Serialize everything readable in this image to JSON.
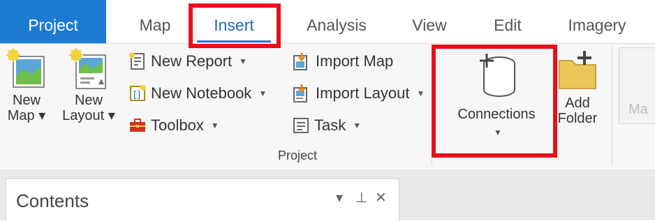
{
  "tabs": [
    {
      "label": "Project"
    },
    {
      "label": "Map"
    },
    {
      "label": "Insert"
    },
    {
      "label": "Analysis"
    },
    {
      "label": "View"
    },
    {
      "label": "Edit"
    },
    {
      "label": "Imagery"
    }
  ],
  "ribbon": {
    "new_map": {
      "line1": "New",
      "line2": "Map ▾"
    },
    "new_layout": {
      "line1": "New",
      "line2": "Layout ▾"
    },
    "new_report": "New Report",
    "new_notebook": "New Notebook",
    "toolbox": "Toolbox",
    "import_map": "Import Map",
    "import_layout": "Import Layout",
    "task": "Task",
    "connections": "Connections",
    "add_folder": {
      "line1": "Add",
      "line2": "Folder"
    },
    "group_label": "Project",
    "cutoff_label": "Ma"
  },
  "contents": {
    "title": "Contents",
    "pin_icon": "pin-icon",
    "close_icon": "close-icon"
  },
  "colors": {
    "project_tab": "#1c7bd1",
    "highlight": "#e8101a",
    "insert_tab_text": "#1c6ab8"
  }
}
